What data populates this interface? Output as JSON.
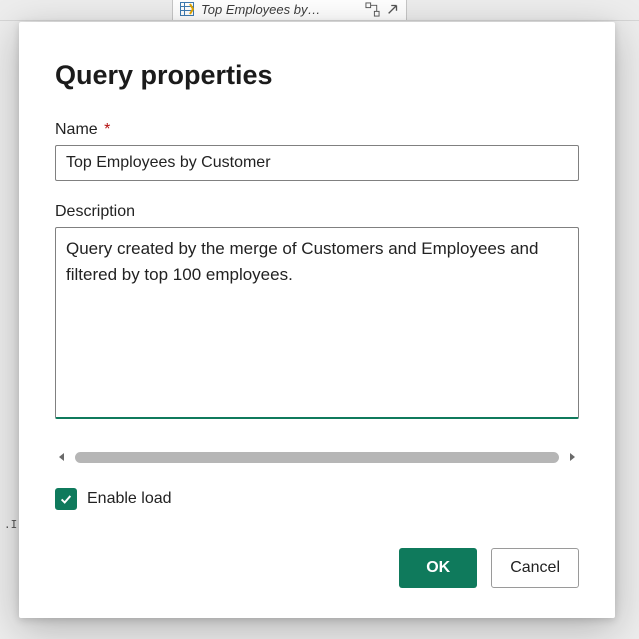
{
  "background": {
    "tab_label": "Top Employees by…",
    "side_text": ".I"
  },
  "dialog": {
    "title": "Query properties",
    "name": {
      "label": "Name",
      "required": "*",
      "value": "Top Employees by Customer"
    },
    "description": {
      "label": "Description",
      "value": "Query created by the merge of Customers and Employees and filtered by top 100 employees."
    },
    "enable_load": {
      "label": "Enable load",
      "checked": true
    },
    "buttons": {
      "ok": "OK",
      "cancel": "Cancel"
    }
  }
}
